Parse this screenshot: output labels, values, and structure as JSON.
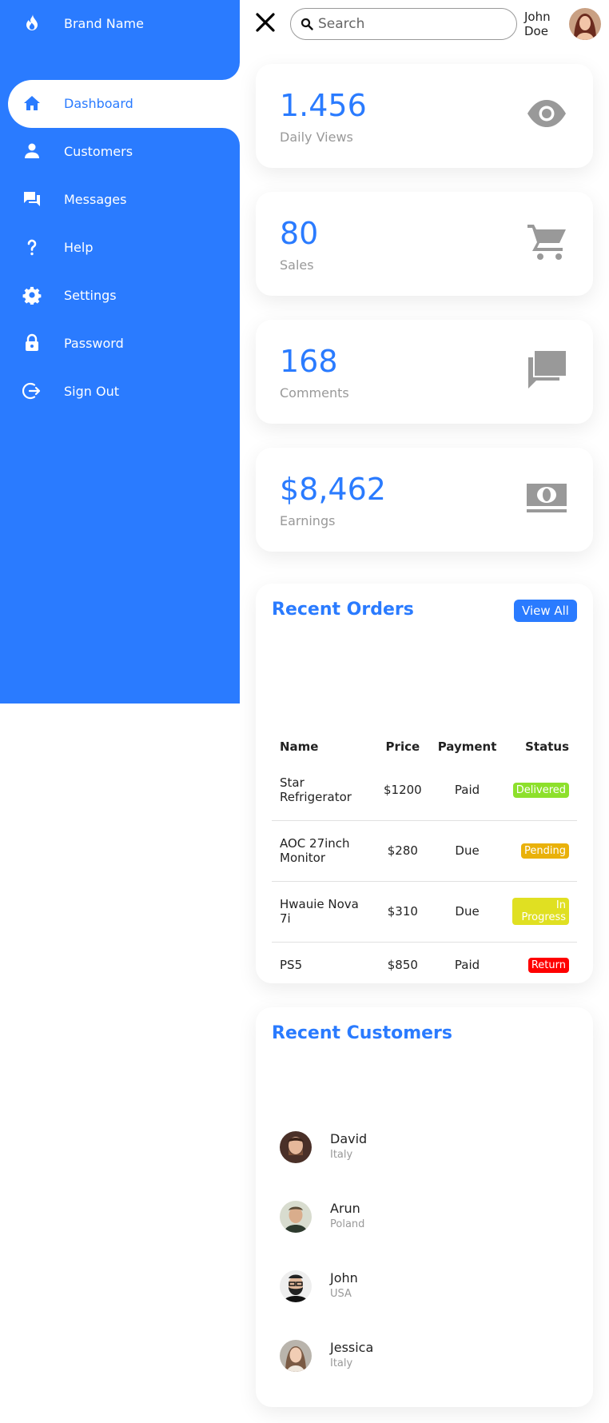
{
  "brand": {
    "name": "Brand Name",
    "icon": "flame-icon"
  },
  "nav": [
    {
      "label": "Dashboard",
      "icon": "home-icon",
      "active": true
    },
    {
      "label": "Customers",
      "icon": "person-icon"
    },
    {
      "label": "Messages",
      "icon": "chat-icon"
    },
    {
      "label": "Help",
      "icon": "help-icon"
    },
    {
      "label": "Settings",
      "icon": "gear-icon"
    },
    {
      "label": "Password",
      "icon": "lock-icon"
    },
    {
      "label": "Sign Out",
      "icon": "sign-out-icon"
    }
  ],
  "topbar": {
    "search_placeholder": "Search",
    "user_first": "John",
    "user_last": "Doe"
  },
  "cards": [
    {
      "number": "1.456",
      "caption": "Daily Views",
      "icon": "eye-icon"
    },
    {
      "number": "80",
      "caption": "Sales",
      "icon": "cart-icon"
    },
    {
      "number": "168",
      "caption": "Comments",
      "icon": "comments-icon"
    },
    {
      "number": "$8,462",
      "caption": "Earnings",
      "icon": "cash-icon"
    }
  ],
  "orders": {
    "title": "Recent Orders",
    "view_all": "View All",
    "headers": {
      "name": "Name",
      "price": "Price",
      "payment": "Payment",
      "status": "Status"
    },
    "rows": [
      {
        "name": "Star Refrigerator",
        "price": "$1200",
        "payment": "Paid",
        "status": "Delivered"
      },
      {
        "name": "AOC 27inch Monitor",
        "price": "$280",
        "payment": "Due",
        "status": "Pending"
      },
      {
        "name": "Hwauie Nova 7i",
        "price": "$310",
        "payment": "Due",
        "status": "In Progress"
      },
      {
        "name": "PS5",
        "price": "$850",
        "payment": "Paid",
        "status": "Return"
      }
    ]
  },
  "status_colors": {
    "Delivered": "#8de02c",
    "Pending": "#e9b10a",
    "In Progress": "#e0e022",
    "Return": "#f00"
  },
  "customers": {
    "title": "Recent Customers",
    "list": [
      {
        "name": "David",
        "country": "Italy"
      },
      {
        "name": "Arun",
        "country": "Poland"
      },
      {
        "name": "John",
        "country": "USA"
      },
      {
        "name": "Jessica",
        "country": "Italy"
      }
    ]
  },
  "colors": {
    "accent": "#2a7bff",
    "muted": "#999999"
  }
}
